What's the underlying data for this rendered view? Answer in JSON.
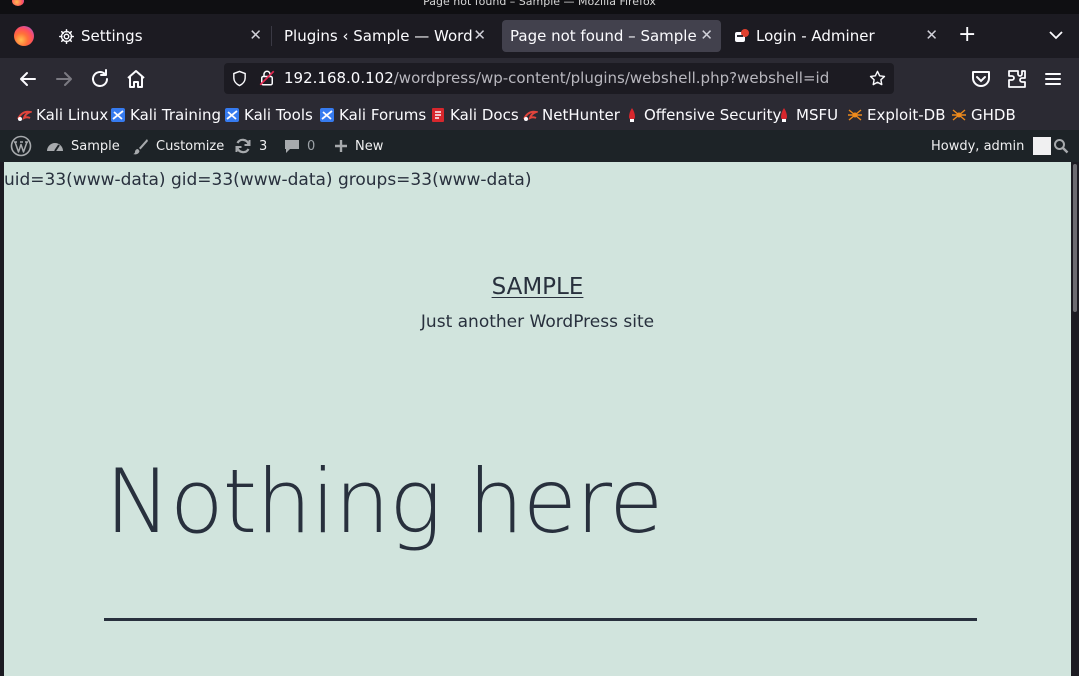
{
  "window": {
    "title": "Page not found – Sample — Mozilla Firefox"
  },
  "tabs": [
    {
      "label": "Settings",
      "icon": "gear-icon",
      "active": false
    },
    {
      "label": "Plugins ‹ Sample — WordPress",
      "icon": "none",
      "active": false
    },
    {
      "label": "Page not found – Sample",
      "icon": "none",
      "active": true
    },
    {
      "label": "Login - Adminer",
      "icon": "adminer-icon",
      "active": false
    }
  ],
  "navbar": {
    "url_host": "192.168.0.102",
    "url_path": "/wordpress/wp-content/plugins/webshell.php?webshell=id"
  },
  "bookmarks": [
    {
      "label": "Kali Linux",
      "icon": "kali-icon"
    },
    {
      "label": "Kali Training",
      "icon": "kali-training-icon"
    },
    {
      "label": "Kali Tools",
      "icon": "kali-tools-icon"
    },
    {
      "label": "Kali Forums",
      "icon": "kali-forums-icon"
    },
    {
      "label": "Kali Docs",
      "icon": "kali-docs-icon"
    },
    {
      "label": "NetHunter",
      "icon": "nethunter-icon"
    },
    {
      "label": "Offensive Security",
      "icon": "offsec-icon"
    },
    {
      "label": "MSFU",
      "icon": "msfu-icon"
    },
    {
      "label": "Exploit-DB",
      "icon": "exploitdb-icon"
    },
    {
      "label": "GHDB",
      "icon": "ghdb-icon"
    }
  ],
  "wp_admin_bar": {
    "site_name": "Sample",
    "customize": "Customize",
    "updates_count": "3",
    "comments_count": "0",
    "new_label": "New",
    "howdy": "Howdy, admin"
  },
  "page": {
    "shell_output": "uid=33(www-data) gid=33(www-data) groups=33(www-data)",
    "site_title": "SAMPLE",
    "site_description": "Just another WordPress site",
    "heading": "Nothing here"
  },
  "colors": {
    "page_background": "#d1e4dd",
    "page_text": "#28303d",
    "browser_chrome": "#2b2a33",
    "tabstrip": "#1c1b22",
    "active_tab": "#42414d",
    "wp_admin_bar": "#1d2327"
  }
}
